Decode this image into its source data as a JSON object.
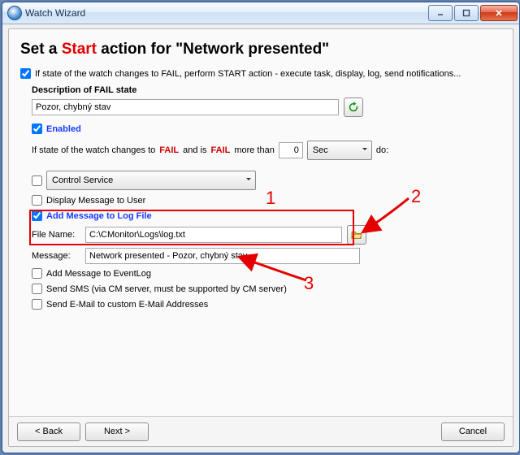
{
  "window": {
    "title": "Watch Wizard"
  },
  "heading": {
    "pre": "Set a ",
    "start": "Start",
    "post": " action for ",
    "target": "\"Network presented\""
  },
  "fail_on_change": {
    "label": "If state of the watch changes to FAIL, perform START action - execute task, display, log, send notifications..."
  },
  "desc": {
    "label": "Description of FAIL state",
    "value": "Pozor, chybný stav",
    "refresh_icon": "refresh"
  },
  "enabled": {
    "label": "Enabled"
  },
  "cond": {
    "pre": "If state of the watch changes to ",
    "fail": "FAIL",
    "mid": " and is ",
    "post": " more than",
    "value": "0",
    "unit": "Sec",
    "after": "do:"
  },
  "action_select": {
    "value": "Control Service"
  },
  "opts": {
    "display_msg": "Display Message to User",
    "add_log": "Add Message to Log File",
    "file_label": "File Name:",
    "file_value": "C:\\CMonitor\\Logs\\log.txt",
    "msg_label": "Message:",
    "msg_value": "Network presented - Pozor, chybný stav",
    "eventlog": "Add Message to EventLog",
    "sms": "Send SMS (via CM server, must be supported by CM server)",
    "email": "Send E-Mail to custom E-Mail Addresses"
  },
  "callouts": {
    "c1": "1",
    "c2": "2",
    "c3": "3"
  },
  "footer": {
    "back": "< Back",
    "next": "Next >",
    "cancel": "Cancel"
  }
}
